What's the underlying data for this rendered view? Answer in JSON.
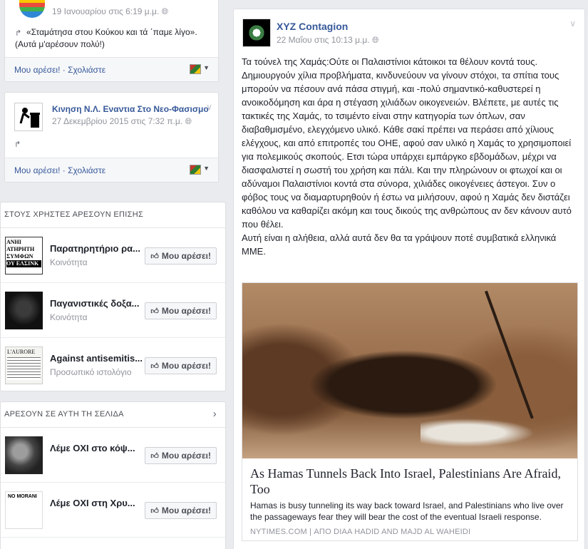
{
  "left_feed": {
    "post1": {
      "date": "19 Ιανουαρίου στις 6:19 μ.μ.",
      "privacy_icon": "globe-icon",
      "text": "«Σταμάτησα στου Κούκου και τά ΄παμε λίγο». (Αυτά μ'αρέσουν πολύ!)",
      "actions": "Μου αρέσει! · Σχολιάστε"
    },
    "post2": {
      "author": "Κινηση Ν.Λ. Εναντια Στο Νεο-Φασισμο",
      "date": "27 Δεκεμβρίου 2015 στις 7:32 π.μ.",
      "privacy_icon": "globe-icon",
      "actions": "Μου αρέσει! · Σχολιάστε"
    }
  },
  "also_like": {
    "header": "ΣΤΟΥΣ ΧΡΗΣΤΕΣ ΑΡΕΣΟΥΝ ΕΠΙΣΗΣ",
    "items": [
      {
        "name": "Παρατηρητήριο ρα...",
        "category": "Κοινότητα",
        "button": "Μου αρέσει!",
        "thumb_text": [
          "ΑΝΗΙ",
          "ΑΤΗΡΗΤΗ",
          "ΣΥΜΦΩΝ",
          "ΟΥ ΕΛΣΙΝΚ"
        ]
      },
      {
        "name": "Παγανιστικές δοξα...",
        "category": "Κοινότητα",
        "button": "Μου αρέσει!"
      },
      {
        "name": "Against antisemitis...",
        "category": "Προσωπικό ιστολόγιο",
        "button": "Μου αρέσει!",
        "thumb_text": [
          "L'AURORE"
        ]
      }
    ]
  },
  "page_likes": {
    "header": "ΑΡΕΣΟΥΝ ΣΕ ΑΥΤΗ ΤΗ ΣΕΛΙΔΑ",
    "items": [
      {
        "name": "Λέμε ΟΧΙ στο κόψ...",
        "button": "Μου αρέσει!"
      },
      {
        "name": "Λέμε ΟΧΙ στη Χρυ...",
        "button": "Μου αρέσει!",
        "thumb_text": [
          "NO MORANI"
        ]
      }
    ]
  },
  "main_post": {
    "author": "XYZ Contagion",
    "date": "22 Μαΐου στις 10:13 μ.μ.",
    "privacy_icon": "globe-icon",
    "paragraph1": "Τα τούνελ της Χαμάς:Ούτε οι Παλαιστίνιοι κάτοικοι τα θέλουν κοντά τους. Δημιουργούν χίλια προβλήματα, κινδυνεύουν να γίνουν στόχοι, τα σπίτια τους μπορούν να πέσουν ανά πάσα στιγμή, και -πολύ σημαντικό-καθυστερεί η ανοικοδόμηση και άρα η στέγαση χιλιάδων οικογενειών. Βλέπετε, με αυτές τις τακτικές της Χαμάς, το τσιμέντο είναι στην κατηγορία των όπλων, σαν διαβαθμισμένο, ελεγχόμενο υλικό. Κάθε σακί πρέπει να περάσει από χίλιους ελέγχους, και από επιτροπές του ΟΗΕ, αφού σαν υλικό η Χαμάς το χρησιμοποιεί για πολεμικούς σκοπούς. Ετσι τώρα υπάρχει εμπάργκο εβδομάδων, μέχρι να διασφαλιστεί η σωστή του χρήση και πάλι. Και την πληρώνουν οι φτωχοί και οι αδύναμοι Παλαιστίνιοι κοντά στα σύνορα, χιλιάδες οικογένειες άστεγοι. Συν ο φόβος τους να διαμαρτυρηθούν ή έστω να μιλήσουν, αφού η Χαμάς δεν διστάζει καθόλου να καθαρίζει ακόμη και τους δικούς της ανθρώπους αν δεν κάνουν αυτό που θέλει.",
    "paragraph2": "Αυτή είναι η αλήθεια, αλλά αυτά δεν θα τα γράψουν ποτέ συμβατικά ελληνικά ΜΜΕ.",
    "link": {
      "headline": "As Hamas Tunnels Back Into Israel, Palestinians Are Afraid, Too",
      "description": "Hamas is busy tunneling its way back toward Israel, and Palestinians who live over the passageways fear they will bear the cost of the eventual Israeli response.",
      "source": "NYTIMES.COM | ΑΠΟ DIAA HADID AND MAJD AL WAHEIDI"
    }
  }
}
